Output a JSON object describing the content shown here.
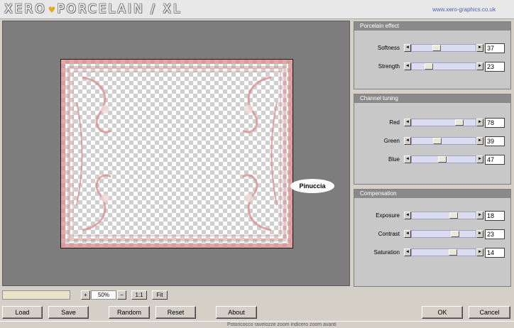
{
  "header": {
    "logo": "XERO",
    "logo_heart": "♥",
    "logo_rest": "PORCELAIN / XL",
    "url": "www.xero-graphics.co.uk"
  },
  "preview": {
    "watermark": "Pinuccia"
  },
  "panels": [
    {
      "title": "Porcelain effect",
      "controls": [
        {
          "label": "Softness",
          "value": "37",
          "fraction": 0.37
        },
        {
          "label": "Strength",
          "value": "23",
          "fraction": 0.23
        }
      ]
    },
    {
      "title": "Channel tuning",
      "controls": [
        {
          "label": "Red",
          "value": "78",
          "fraction": 0.78
        },
        {
          "label": "Green",
          "value": "39",
          "fraction": 0.39
        },
        {
          "label": "Blue",
          "value": "47",
          "fraction": 0.47
        }
      ]
    },
    {
      "title": "Compensation",
      "controls": [
        {
          "label": "Exposure",
          "value": "18",
          "fraction": 0.68
        },
        {
          "label": "Contrast",
          "value": "23",
          "fraction": 0.7
        },
        {
          "label": "Saturation",
          "value": "14",
          "fraction": 0.67
        }
      ]
    }
  ],
  "zoom": {
    "plus": "+",
    "value": "50%",
    "minus": "−",
    "one_to_one": "1:1",
    "fit": "Fit"
  },
  "buttons": {
    "load": "Load",
    "save": "Save",
    "random": "Random",
    "reset": "Reset",
    "about": "About",
    "ok": "OK",
    "cancel": "Cancel"
  },
  "taskbar": "Potoricocco     raveiozze     zoom indicero     zoom avanti",
  "icons": {
    "left_arrow": "◄",
    "right_arrow": "►"
  }
}
